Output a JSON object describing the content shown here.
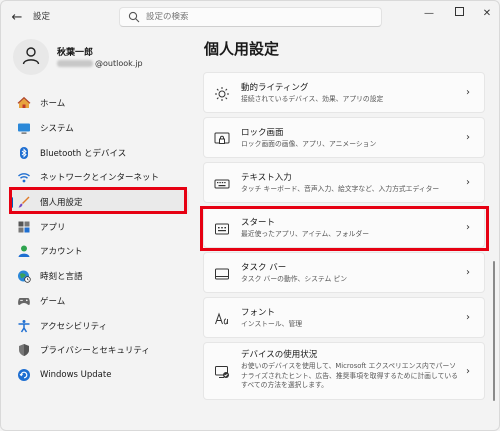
{
  "window": {
    "title": "設定"
  },
  "search": {
    "placeholder": "設定の検索"
  },
  "profile": {
    "name": "秋葉一郎",
    "email_suffix": "@outlook.jp"
  },
  "page_title": "個人用設定",
  "sidebar": {
    "items": [
      {
        "label": "ホーム",
        "icon": "home-icon"
      },
      {
        "label": "システム",
        "icon": "monitor-icon"
      },
      {
        "label": "Bluetooth とデバイス",
        "icon": "bluetooth-icon"
      },
      {
        "label": "ネットワークとインターネット",
        "icon": "wifi-icon"
      },
      {
        "label": "個人用設定",
        "icon": "brush-icon",
        "active": true
      },
      {
        "label": "アプリ",
        "icon": "apps-icon"
      },
      {
        "label": "アカウント",
        "icon": "account-icon"
      },
      {
        "label": "時刻と言語",
        "icon": "globe-clock-icon"
      },
      {
        "label": "ゲーム",
        "icon": "gamepad-icon"
      },
      {
        "label": "アクセシビリティ",
        "icon": "accessibility-icon"
      },
      {
        "label": "プライバシーとセキュリティ",
        "icon": "shield-icon"
      },
      {
        "label": "Windows Update",
        "icon": "update-icon"
      }
    ]
  },
  "cards": [
    {
      "title": "動的ライティング",
      "subtitle": "接続されているデバイス、効果、アプリの設定",
      "icon": "sun-icon"
    },
    {
      "title": "ロック画面",
      "subtitle": "ロック画面の画像、アプリ、アニメーション",
      "icon": "lock-screen-icon"
    },
    {
      "title": "テキスト入力",
      "subtitle": "タッチ キーボード、音声入力、絵文字など、入力方式エディター",
      "icon": "keyboard-icon"
    },
    {
      "title": "スタート",
      "subtitle": "最近使ったアプリ、アイテム、フォルダー",
      "icon": "start-icon"
    },
    {
      "title": "タスク バー",
      "subtitle": "タスク バーの動作、システム ピン",
      "icon": "taskbar-icon"
    },
    {
      "title": "フォント",
      "subtitle": "インストール、管理",
      "icon": "font-icon"
    },
    {
      "title": "デバイスの使用状況",
      "subtitle": "お使いのデバイスを使用して、Microsoft エクスペリエンス内でパーソナライズされたヒント、広告、推奨事項を取得するために計画しているすべての方法を選択します。",
      "icon": "device-usage-icon"
    }
  ],
  "colors": {
    "accent": "#005fb8",
    "highlight": "#e60012"
  }
}
